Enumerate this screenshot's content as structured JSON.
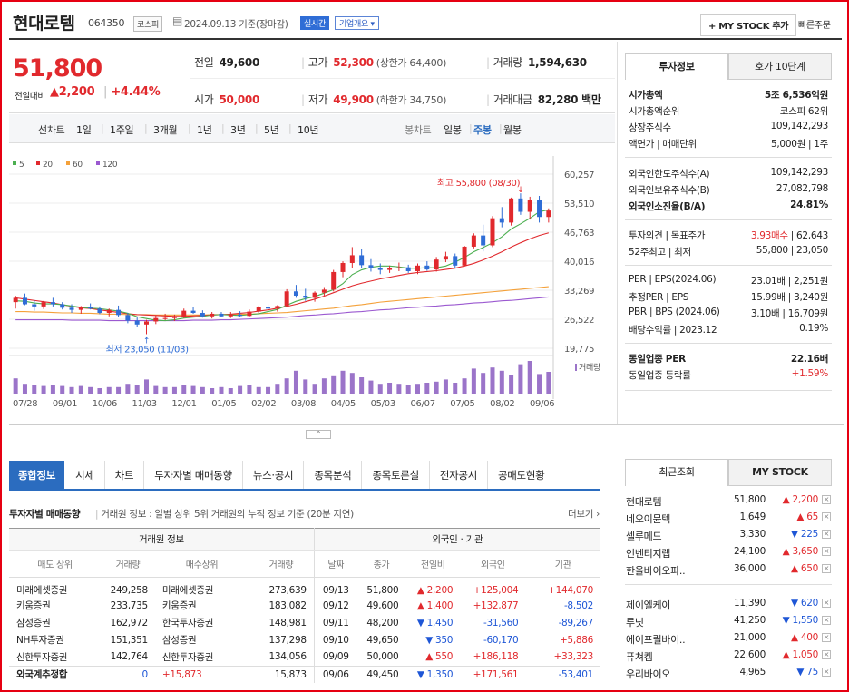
{
  "header": {
    "name": "현대로템",
    "code": "064350",
    "market": "코스피",
    "date_text": "2024.09.13 기준(장마감)",
    "realtime": "실시간",
    "company_info": "기업개요",
    "mystock_btn": "+ MY STOCK 추가",
    "quick_order": "빠른주문"
  },
  "price": {
    "current": "51,800",
    "change_label": "전일대비",
    "change": "▲2,200",
    "change_pct": "+4.44%"
  },
  "summary": [
    {
      "label": "전일",
      "value": "49,600",
      "extra": ""
    },
    {
      "label": "고가",
      "value": "52,300",
      "extra": "(상한가 64,400)"
    },
    {
      "label": "거래량",
      "value": "1,594,630",
      "extra": ""
    },
    {
      "label": "시가",
      "value": "50,000",
      "extra": ""
    },
    {
      "label": "저가",
      "value": "49,900",
      "extra": "(하한가 34,750)"
    },
    {
      "label": "거래대금",
      "value": "82,280 백만",
      "extra": ""
    }
  ],
  "chart_tabs": {
    "line_label": "선차트",
    "periods": [
      "1일",
      "1주일",
      "3개월",
      "1년",
      "3년",
      "5년",
      "10년"
    ],
    "candle_label": "봉차트",
    "candle_periods": [
      "일봉",
      "주봉",
      "월봉"
    ],
    "candle_active": "주봉"
  },
  "chart_data": {
    "type": "candlestick",
    "legend": [
      "5",
      "20",
      "60",
      "120"
    ],
    "legend_colors": [
      "#4caf50",
      "#e1292d",
      "#f4a13a",
      "#9b59d0"
    ],
    "y_ticks": [
      "60,257",
      "53,510",
      "46,763",
      "40,016",
      "33,269",
      "26,522",
      "19,775"
    ],
    "x_ticks": [
      "07/28",
      "09/01",
      "10/06",
      "11/03",
      "12/01",
      "01/05",
      "02/02",
      "03/08",
      "04/05",
      "05/03",
      "06/07",
      "07/05",
      "08/02",
      "09/06"
    ],
    "high_annotation": "최고 55,800 (08/30)",
    "low_annotation": "최저 23,050 (11/03)",
    "volume_label": "거래량",
    "ylim": [
      19775,
      60257
    ],
    "candles": [
      [
        30500,
        32000,
        29000,
        31500
      ],
      [
        31500,
        32500,
        29800,
        30000
      ],
      [
        30000,
        31000,
        28500,
        29500
      ],
      [
        29500,
        30800,
        28900,
        30500
      ],
      [
        30500,
        31500,
        29500,
        30000
      ],
      [
        30000,
        30500,
        28800,
        29200
      ],
      [
        29200,
        30000,
        28000,
        28700
      ],
      [
        28700,
        29600,
        27800,
        29300
      ],
      [
        29300,
        30200,
        28800,
        29000
      ],
      [
        29000,
        29500,
        27700,
        28000
      ],
      [
        28000,
        29000,
        27200,
        28700
      ],
      [
        28700,
        29700,
        27000,
        27500
      ],
      [
        27500,
        28000,
        25600,
        26200
      ],
      [
        26200,
        27100,
        24800,
        25300
      ],
      [
        25300,
        26400,
        23050,
        26000
      ],
      [
        26000,
        27400,
        25400,
        26800
      ],
      [
        26800,
        27800,
        26300,
        26800
      ],
      [
        26800,
        27600,
        26100,
        27200
      ],
      [
        27200,
        29000,
        26800,
        28500
      ],
      [
        28500,
        29300,
        27800,
        28000
      ],
      [
        28000,
        28600,
        26900,
        27200
      ],
      [
        27200,
        28200,
        26700,
        27800
      ],
      [
        27800,
        28200,
        27000,
        27200
      ],
      [
        27200,
        28200,
        26800,
        27600
      ],
      [
        27600,
        28400,
        27000,
        27300
      ],
      [
        27300,
        28800,
        27000,
        28300
      ],
      [
        28300,
        29600,
        27900,
        29300
      ],
      [
        29300,
        30000,
        28500,
        29000
      ],
      [
        29000,
        29800,
        28300,
        29600
      ],
      [
        29600,
        33500,
        29300,
        33000
      ],
      [
        33000,
        34500,
        31500,
        32000
      ],
      [
        32000,
        33600,
        30800,
        31500
      ],
      [
        31500,
        33000,
        30600,
        32700
      ],
      [
        32700,
        34000,
        32000,
        33400
      ],
      [
        33400,
        38000,
        33000,
        37500
      ],
      [
        37500,
        40000,
        36300,
        39600
      ],
      [
        39600,
        43300,
        38500,
        41400
      ],
      [
        41400,
        42800,
        38500,
        39100
      ],
      [
        39100,
        40500,
        37600,
        38400
      ],
      [
        38400,
        39500,
        37000,
        38000
      ],
      [
        38000,
        39000,
        37300,
        38400
      ],
      [
        38400,
        39700,
        37700,
        38600
      ],
      [
        38600,
        39200,
        37300,
        37700
      ],
      [
        37700,
        39500,
        37000,
        39000
      ],
      [
        39000,
        40000,
        37800,
        38100
      ],
      [
        38100,
        41000,
        37600,
        40400
      ],
      [
        40400,
        42200,
        39800,
        41200
      ],
      [
        41200,
        41800,
        38500,
        39000
      ],
      [
        39000,
        43600,
        38800,
        43400
      ],
      [
        43400,
        46500,
        43000,
        46000
      ],
      [
        46000,
        48500,
        42300,
        43700
      ],
      [
        43700,
        50500,
        43300,
        50000
      ],
      [
        50000,
        52600,
        47900,
        49000
      ],
      [
        49000,
        54800,
        48300,
        54600
      ],
      [
        54600,
        55800,
        50800,
        51500
      ],
      [
        51500,
        55000,
        49700,
        54300
      ],
      [
        54300,
        55200,
        49000,
        50300
      ],
      [
        50300,
        52300,
        49000,
        51800
      ]
    ],
    "volumes": [
      14,
      9,
      8,
      7,
      8,
      7,
      6,
      7,
      6,
      5,
      6,
      6,
      9,
      8,
      13,
      7,
      6,
      6,
      8,
      7,
      6,
      5,
      6,
      5,
      7,
      8,
      6,
      6,
      9,
      14,
      21,
      13,
      9,
      14,
      16,
      21,
      19,
      15,
      12,
      9,
      10,
      9,
      8,
      9,
      10,
      11,
      13,
      10,
      14,
      23,
      19,
      24,
      21,
      17,
      27,
      30,
      18,
      20
    ],
    "ma5": [
      30800,
      30700,
      30300,
      30100,
      30100,
      29900,
      29600,
      29300,
      29100,
      29000,
      28700,
      28400,
      27900,
      27100,
      26700,
      26300,
      26200,
      26400,
      26800,
      27000,
      27200,
      27500,
      27600,
      27500,
      27400,
      27600,
      27800,
      28300,
      28800,
      29800,
      30700,
      31300,
      31800,
      32600,
      33400,
      34800,
      36900,
      38000,
      38600,
      38900,
      38900,
      38700,
      38400,
      38400,
      38500,
      38500,
      38900,
      39800,
      40900,
      42200,
      43200,
      44300,
      45700,
      47500,
      48700,
      50000,
      51500,
      52000
    ],
    "ma20": [
      31500,
      31200,
      30900,
      30600,
      30300,
      29900,
      29500,
      29200,
      29000,
      28700,
      28400,
      28100,
      27800,
      27600,
      27500,
      27400,
      27300,
      27200,
      27200,
      27300,
      27400,
      27500,
      27600,
      27700,
      27900,
      28100,
      28400,
      28700,
      29100,
      29500,
      30000,
      30600,
      31200,
      31900,
      32700,
      33500,
      34300,
      34900,
      35400,
      35900,
      36300,
      36700,
      37100,
      37400,
      37600,
      37800,
      38100,
      38400,
      38900,
      39500,
      40300,
      41200,
      42200,
      43300,
      44300,
      45200,
      46000,
      46600
    ],
    "ma60": [
      28300,
      28300,
      28200,
      28200,
      28100,
      28000,
      28000,
      27900,
      27900,
      27800,
      27700,
      27700,
      27600,
      27600,
      27600,
      27500,
      27500,
      27500,
      27500,
      27500,
      27500,
      27600,
      27600,
      27600,
      27700,
      27700,
      27800,
      27900,
      28000,
      28100,
      28300,
      28500,
      28700,
      28900,
      29100,
      29400,
      29700,
      29900,
      30200,
      30500,
      30700,
      30900,
      31100,
      31300,
      31500,
      31700,
      31900,
      32100,
      32300,
      32500,
      32700,
      32900,
      33100,
      33300,
      33500,
      33700,
      33900,
      34100
    ],
    "ma120": [
      26400,
      26400,
      26400,
      26400,
      26400,
      26400,
      26300,
      26300,
      26300,
      26300,
      26200,
      26200,
      26200,
      26200,
      26200,
      26200,
      26200,
      26200,
      26200,
      26300,
      26300,
      26300,
      26400,
      26400,
      26500,
      26600,
      26700,
      26800,
      26900,
      27000,
      27200,
      27400,
      27500,
      27700,
      27800,
      28000,
      28200,
      28300,
      28500,
      28700,
      28800,
      29000,
      29200,
      29300,
      29500,
      29600,
      29800,
      29900,
      30100,
      30300,
      30400,
      30600,
      30800,
      30900,
      31100,
      31300,
      31500,
      31700
    ]
  },
  "right_panel": {
    "tabs": [
      "투자정보",
      "호가 10단계"
    ],
    "rows": [
      {
        "l": "시가총액",
        "r": "5조 6,536억원",
        "bold": true
      },
      {
        "l": "시가총액순위",
        "r": "코스피 62위"
      },
      {
        "l": "상장주식수",
        "r": "109,142,293"
      },
      {
        "l": "액면가 | 매매단위",
        "r": "5,000원 | 1주"
      },
      {
        "l": "외국인한도주식수(A)",
        "r": "109,142,293"
      },
      {
        "l": "외국인보유주식수(B)",
        "r": "27,082,798"
      },
      {
        "l": "외국인소진율(B/A)",
        "r": "24.81%",
        "bold": true
      },
      {
        "l": "투자의견 | 목표주가",
        "r1": "3.93매수",
        "r2": " | 62,643"
      },
      {
        "l": "52주최고 | 최저",
        "r": "55,800 | 23,050"
      },
      {
        "l": "PER | EPS(2024.06)",
        "r": "23.01배 | 2,251원"
      },
      {
        "l": "추정PER | EPS",
        "r": "15.99배 | 3,240원"
      },
      {
        "l": "PBR | BPS (2024.06)",
        "r": "3.10배 | 16,709원"
      },
      {
        "l": "배당수익률 | 2023.12",
        "r": "0.19%"
      },
      {
        "l": "동일업종 PER",
        "r": "22.16배",
        "bold": true
      },
      {
        "l": "동일업종 등락률",
        "r": "+1.59%",
        "red": true
      }
    ]
  },
  "bottom_tabs": [
    "종합정보",
    "시세",
    "차트",
    "투자자별 매매동향",
    "뉴스·공시",
    "종목분석",
    "종목토론실",
    "전자공시",
    "공매도현황"
  ],
  "investor": {
    "title": "투자자별 매매동향",
    "desc": "거래원 정보 : 일별 상위 5위 거래원의 누적 정보 기준 (20분 지연)",
    "more": "더보기",
    "group1": "거래원 정보",
    "group2": "외국인 · 기관",
    "cols": [
      "매도 상위",
      "거래량",
      "매수상위",
      "거래량",
      "날짜",
      "종가",
      "전일비",
      "외국인",
      "기관"
    ],
    "rows": [
      [
        "미래에셋증권",
        "249,258",
        "미래에셋증권",
        "273,639",
        "09/13",
        "51,800",
        "▲ 2,200",
        "+125,004",
        "+144,070"
      ],
      [
        "키움증권",
        "233,735",
        "키움증권",
        "183,082",
        "09/12",
        "49,600",
        "▲ 1,400",
        "+132,877",
        "-8,502"
      ],
      [
        "삼성증권",
        "162,972",
        "한국투자증권",
        "148,981",
        "09/11",
        "48,200",
        "▼ 1,450",
        "-31,560",
        "-89,267"
      ],
      [
        "NH투자증권",
        "151,351",
        "삼성증권",
        "137,298",
        "09/10",
        "49,650",
        "▼ 350",
        "-60,170",
        "+5,886"
      ],
      [
        "신한투자증권",
        "142,764",
        "신한투자증권",
        "134,056",
        "09/09",
        "50,000",
        "▲ 550",
        "+186,118",
        "+33,323"
      ],
      [
        "외국계추정합",
        "0",
        "+15,873",
        "15,873",
        "09/06",
        "49,450",
        "▼ 1,350",
        "+171,561",
        "-53,401"
      ]
    ]
  },
  "recent": {
    "tabs": [
      "최근조회",
      "MY STOCK"
    ],
    "items": [
      {
        "n": "현대로템",
        "p": "51,800",
        "c": "▲ 2,200",
        "up": true
      },
      {
        "n": "네오이뮨텍",
        "p": "1,649",
        "c": "▲ 65",
        "up": true
      },
      {
        "n": "셀루메드",
        "p": "3,330",
        "c": "▼ 225",
        "up": false
      },
      {
        "n": "인벤티지랩",
        "p": "24,100",
        "c": "▲ 3,650",
        "up": true
      },
      {
        "n": "한올바이오파..",
        "p": "36,000",
        "c": "▲ 650",
        "up": true
      },
      {
        "n": "제이엘케이",
        "p": "11,390",
        "c": "▼ 620",
        "up": false
      },
      {
        "n": "루닛",
        "p": "41,250",
        "c": "▼ 1,550",
        "up": false
      },
      {
        "n": "에이프릴바이..",
        "p": "21,000",
        "c": "▲ 400",
        "up": true
      },
      {
        "n": "퓨쳐켐",
        "p": "22,600",
        "c": "▲ 1,050",
        "up": true
      },
      {
        "n": "우리바이오",
        "p": "4,965",
        "c": "▼ 75",
        "up": false
      }
    ]
  }
}
